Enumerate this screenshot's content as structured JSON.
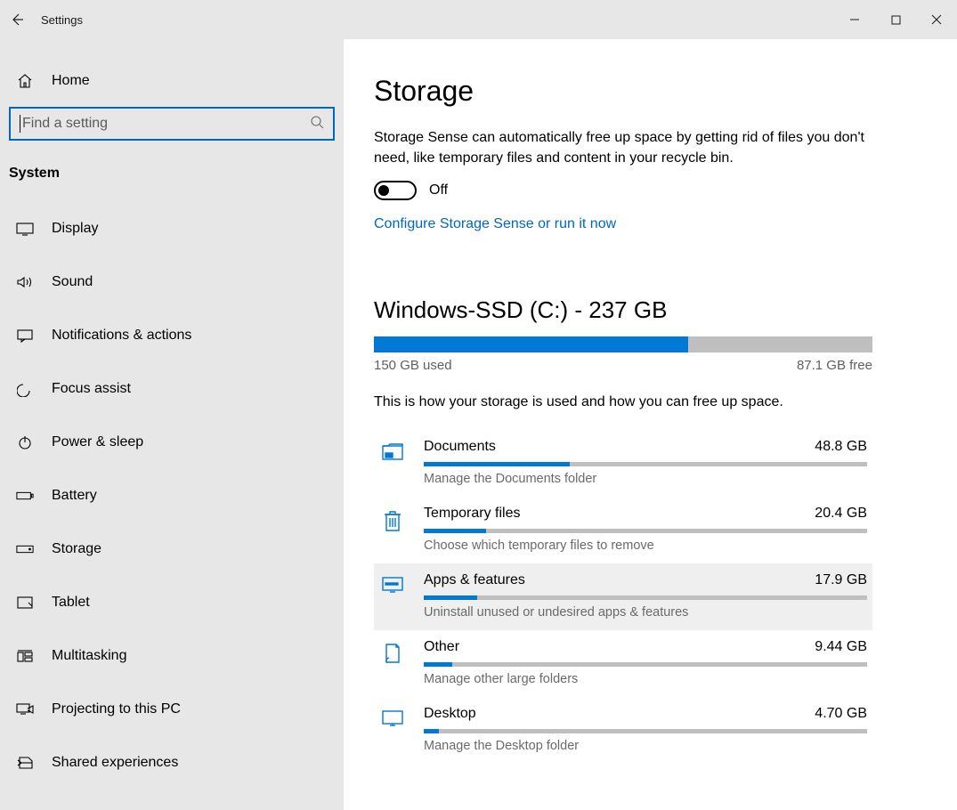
{
  "window": {
    "title": "Settings"
  },
  "sidebar": {
    "home_label": "Home",
    "search_placeholder": "Find a setting",
    "section_header": "System",
    "items": [
      "Display",
      "Sound",
      "Notifications & actions",
      "Focus assist",
      "Power & sleep",
      "Battery",
      "Storage",
      "Tablet",
      "Multitasking",
      "Projecting to this PC",
      "Shared experiences"
    ]
  },
  "main": {
    "title": "Storage",
    "description": "Storage Sense can automatically free up space by getting rid of files you don't need, like temporary files and content in your recycle bin.",
    "toggle_label": "Off",
    "configure_link": "Configure Storage Sense or run it now",
    "drive": {
      "heading": "Windows-SSD (C:) - 237 GB",
      "used_label": "150 GB used",
      "free_label": "87.1 GB free",
      "used_fraction": 0.63
    },
    "usage_description": "This is how your storage is used and how you can free up space.",
    "categories": [
      {
        "name": "Documents",
        "size": "48.8 GB",
        "fraction": 0.33,
        "sub": "Manage the Documents folder"
      },
      {
        "name": "Temporary files",
        "size": "20.4 GB",
        "fraction": 0.14,
        "sub": "Choose which temporary files to remove"
      },
      {
        "name": "Apps & features",
        "size": "17.9 GB",
        "fraction": 0.12,
        "sub": "Uninstall unused or undesired apps & features",
        "hovered": true
      },
      {
        "name": "Other",
        "size": "9.44 GB",
        "fraction": 0.065,
        "sub": "Manage other large folders"
      },
      {
        "name": "Desktop",
        "size": "4.70 GB",
        "fraction": 0.035,
        "sub": "Manage the Desktop folder"
      }
    ]
  }
}
